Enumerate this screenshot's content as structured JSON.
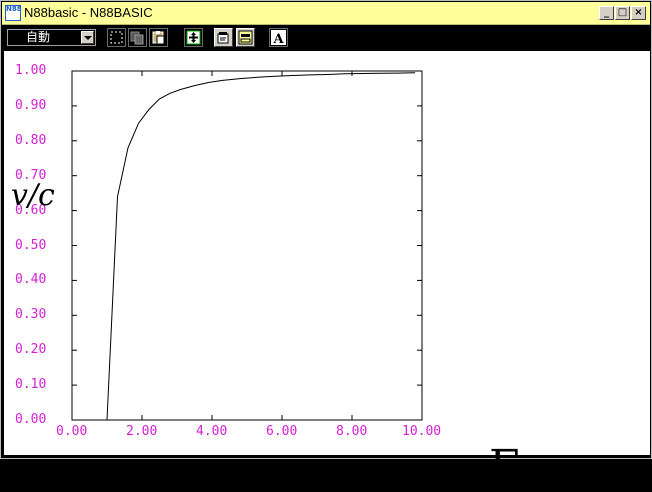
{
  "window": {
    "title": "N88basic - N88BASIC",
    "app_icon_text": "N88",
    "controls": [
      "_",
      "□",
      "×"
    ]
  },
  "toolbar": {
    "mode_value": "自動",
    "buttons": [
      {
        "name": "select-area",
        "icon": "dashed-rect-icon",
        "active": false
      },
      {
        "name": "copy",
        "icon": "copy-icon",
        "active": false
      },
      {
        "name": "paste",
        "icon": "paste-icon",
        "active": false
      },
      {
        "name": "fit-window",
        "icon": "fit-window-icon",
        "active": false
      },
      {
        "name": "properties",
        "icon": "properties-icon",
        "active": true
      },
      {
        "name": "window-mode",
        "icon": "window-mode-icon",
        "active": true
      },
      {
        "name": "font",
        "icon": "font-icon",
        "label": "A",
        "active": false
      }
    ]
  },
  "chart_data": {
    "type": "line",
    "ylabel": "v/c",
    "xlabel": "Γ",
    "xlim": [
      0,
      10
    ],
    "ylim": [
      0,
      1
    ],
    "x_ticks": [
      "0.00",
      "2.00",
      "4.00",
      "6.00",
      "8.00",
      "10.00"
    ],
    "y_ticks": [
      "1.00",
      "0.90",
      "0.80",
      "0.70",
      "0.60",
      "0.50",
      "0.40",
      "0.30",
      "0.20",
      "0.10",
      "0.00"
    ],
    "tick_color": "#d41fd4",
    "series": [
      {
        "x": [
          1.0,
          1.3,
          1.6,
          1.9,
          2.2,
          2.5,
          2.8,
          3.1,
          3.5,
          3.9,
          4.3,
          4.8,
          5.3,
          5.8,
          6.3,
          6.8,
          7.3,
          7.8,
          8.3,
          8.8,
          9.3,
          9.8
        ],
        "y": [
          0.0,
          0.64,
          0.78,
          0.85,
          0.89,
          0.92,
          0.936,
          0.947,
          0.958,
          0.967,
          0.973,
          0.978,
          0.982,
          0.985,
          0.987,
          0.989,
          0.99,
          0.992,
          0.993,
          0.9935,
          0.994,
          0.995
        ]
      }
    ]
  }
}
